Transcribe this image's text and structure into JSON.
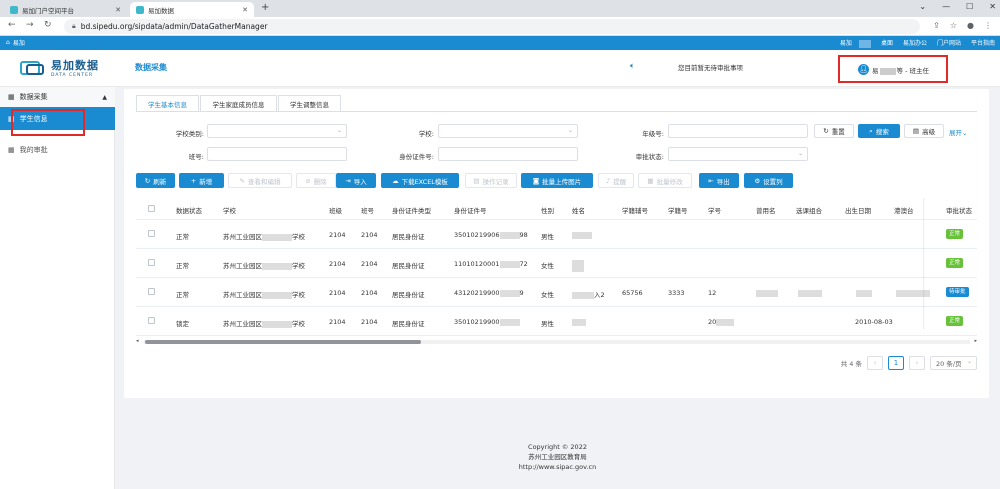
{
  "browser": {
    "tabs": [
      {
        "label": "易加门户空间平台",
        "active": false
      },
      {
        "label": "易加数据",
        "active": true
      }
    ],
    "url": "bd.sipedu.org/sipdata/admin/DataGatherManager"
  },
  "topstrip": {
    "home_label": "易加",
    "links": [
      "易加",
      "桌面",
      "易加办公",
      "门户网站",
      "平台指南"
    ]
  },
  "header": {
    "logo_title": "易加数据",
    "logo_subtitle": "DATA CENTER",
    "nav_title": "数据采集",
    "notice": "您目前暂无待审批事项",
    "user_prefix": "易",
    "user_suffix": "等 - 班主任"
  },
  "sidebar": {
    "section": "数据采集",
    "items": [
      {
        "label": "学生信息",
        "active": true
      },
      {
        "label": "我的审批",
        "active": false
      }
    ]
  },
  "subtabs": [
    "学生基本信息",
    "学生家庭成员信息",
    "学生调整信息"
  ],
  "filters": {
    "school_type_label": "学校类别:",
    "school_label": "学校:",
    "grade_label": "年级号:",
    "class_label": "班号:",
    "idno_label": "身份证件号:",
    "approval_label": "审批状态:",
    "reset": "重置",
    "search": "搜索",
    "advanced": "高级",
    "expand": "展开"
  },
  "toolbar": [
    "刷新",
    "新增",
    "查看和编辑",
    "删除",
    "导入",
    "下载EXCEL模板",
    "操作记录",
    "批量上传图片",
    "提醒",
    "批量修改",
    "导出",
    "设置列"
  ],
  "table": {
    "headers": [
      "数据状态",
      "学校",
      "班级",
      "班号",
      "身份证件类型",
      "身份证件号",
      "性别",
      "姓名",
      "学籍辅号",
      "学籍号",
      "学号",
      "曾用名",
      "选课组合",
      "出生日期",
      "港澳台",
      "审批状态"
    ],
    "rows": [
      {
        "status": "正常",
        "school_a": "苏州工业园区",
        "school_b": "学校",
        "grade": "2104",
        "classno": "2104",
        "idtype": "居民身份证",
        "id_a": "35010219906",
        "id_b": "98",
        "gender": "男性",
        "name_suffix": "",
        "aux": "",
        "sid": "",
        "stuno": "",
        "birth": "",
        "approval": "正常",
        "approval_color": "#67c23a"
      },
      {
        "status": "正常",
        "school_a": "苏州工业园区",
        "school_b": "学校",
        "grade": "2104",
        "classno": "2104",
        "idtype": "居民身份证",
        "id_a": "11010120001",
        "id_b": "72",
        "gender": "女性",
        "name_suffix": "",
        "aux": "",
        "sid": "",
        "stuno": "",
        "birth": "",
        "approval": "正常",
        "approval_color": "#67c23a"
      },
      {
        "status": "正常",
        "school_a": "苏州工业园区",
        "school_b": "学校",
        "grade": "2104",
        "classno": "2104",
        "idtype": "居民身份证",
        "id_a": "43120219900",
        "id_b": "9",
        "gender": "女性",
        "name_suffix": "入2",
        "aux": "65756",
        "sid": "3333",
        "stuno": "12",
        "birth": "",
        "approval": "待审批",
        "approval_color": "#1b8bd1"
      },
      {
        "status": "锁定",
        "school_a": "苏州工业园区",
        "school_b": "学校",
        "grade": "2104",
        "classno": "2104",
        "idtype": "居民身份证",
        "id_a": "35010219900",
        "id_b": "",
        "gender": "男性",
        "name_suffix": "",
        "aux": "",
        "sid": "",
        "stuno": "20",
        "birth": "2010-08-03",
        "approval": "正常",
        "approval_color": "#67c23a"
      }
    ]
  },
  "pagination": {
    "total": "共 4 条",
    "current": "1",
    "page_size": "20 条/页"
  },
  "footer": {
    "copyright": "Copyright © 2022",
    "org": "苏州工业园区教育局",
    "url": "http://www.sipac.gov.cn"
  }
}
